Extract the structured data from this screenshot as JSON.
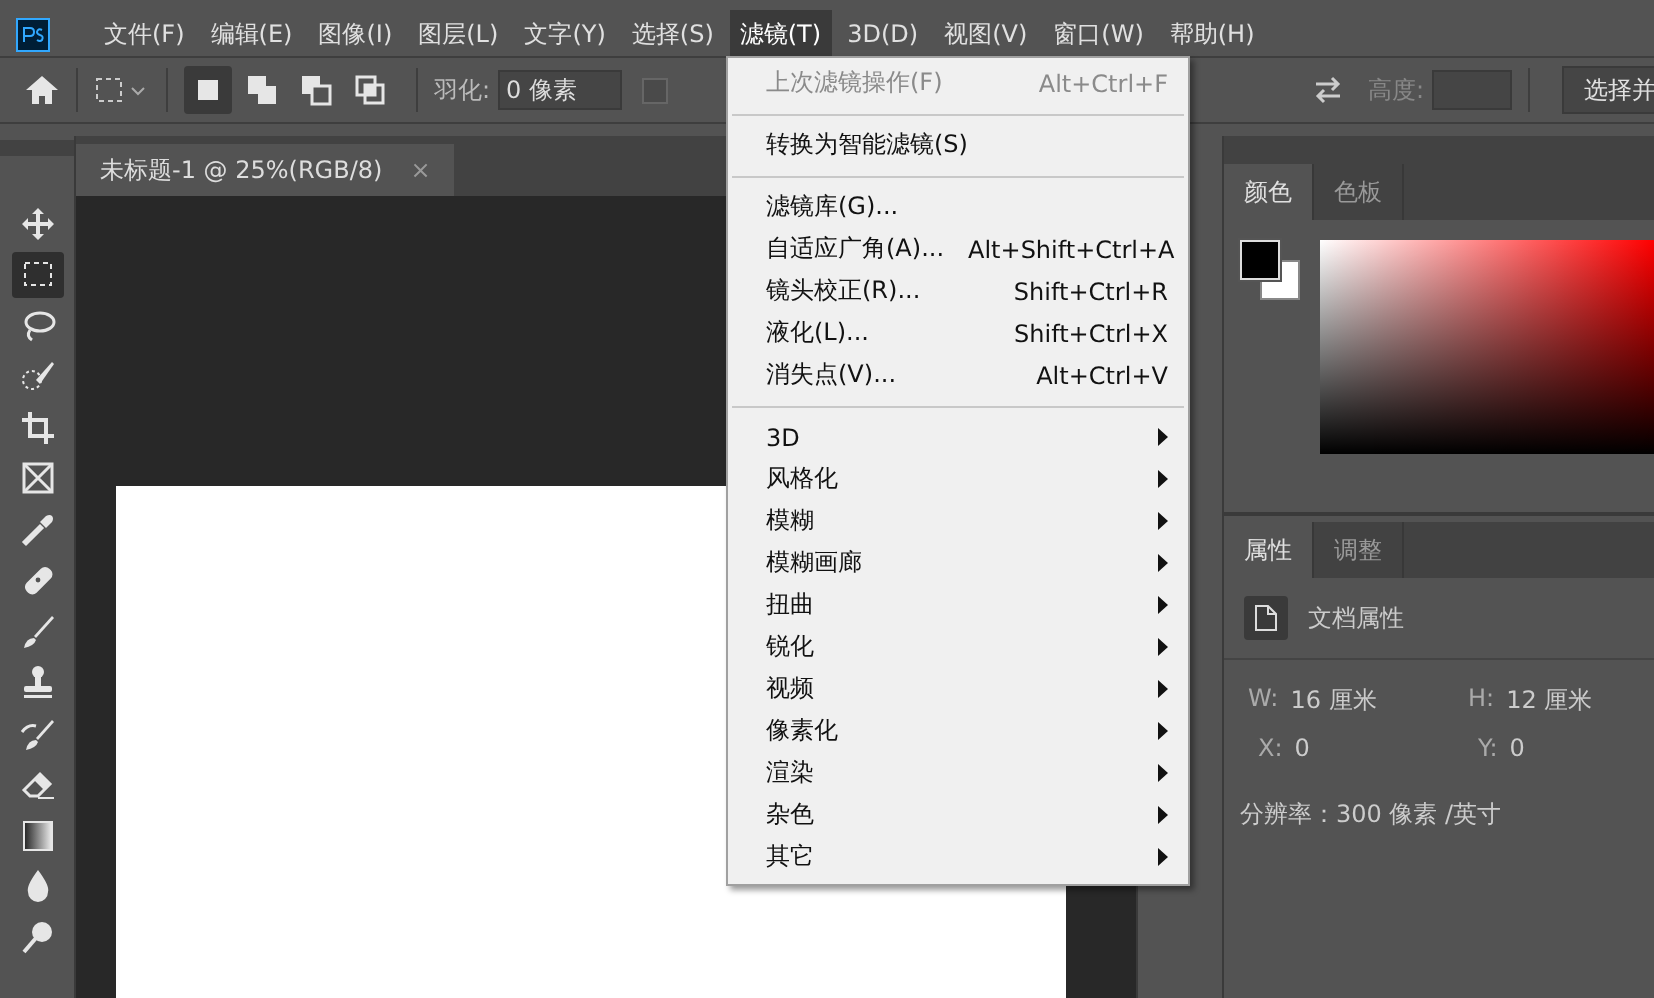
{
  "menubar": {
    "items": [
      {
        "label": "文件(F)",
        "selected": false
      },
      {
        "label": "编辑(E)",
        "selected": false
      },
      {
        "label": "图像(I)",
        "selected": false
      },
      {
        "label": "图层(L)",
        "selected": false
      },
      {
        "label": "文字(Y)",
        "selected": false
      },
      {
        "label": "选择(S)",
        "selected": false
      },
      {
        "label": "滤镜(T)",
        "selected": true
      },
      {
        "label": "3D(D)",
        "selected": false
      },
      {
        "label": "视图(V)",
        "selected": false
      },
      {
        "label": "窗口(W)",
        "selected": false
      },
      {
        "label": "帮助(H)",
        "selected": false
      }
    ]
  },
  "options_bar": {
    "modes": [
      {
        "kind": "new",
        "selected": true
      },
      {
        "kind": "add",
        "selected": false
      },
      {
        "kind": "subtract",
        "selected": false
      },
      {
        "kind": "intersect",
        "selected": false
      }
    ],
    "feather_label": "羽化:",
    "feather_value": "0 像素",
    "anti_alias_checked": false,
    "height_label": "高度:",
    "select_button": "选择并"
  },
  "toolbar": {
    "tools": [
      {
        "kind": "move",
        "selected": false
      },
      {
        "kind": "marquee",
        "selected": true
      },
      {
        "kind": "lasso",
        "selected": false
      },
      {
        "kind": "quick-select",
        "selected": false
      },
      {
        "kind": "crop",
        "selected": false
      },
      {
        "kind": "frame",
        "selected": false
      },
      {
        "kind": "eyedropper",
        "selected": false
      },
      {
        "kind": "healing",
        "selected": false
      },
      {
        "kind": "brush",
        "selected": false
      },
      {
        "kind": "stamp",
        "selected": false
      },
      {
        "kind": "history-brush",
        "selected": false
      },
      {
        "kind": "eraser",
        "selected": false
      },
      {
        "kind": "gradient",
        "selected": false
      },
      {
        "kind": "blur",
        "selected": false
      },
      {
        "kind": "dodge",
        "selected": false
      }
    ]
  },
  "document_tab": {
    "title": "未标题-1 @ 25%(RGB/8)",
    "close": "×"
  },
  "color_panel": {
    "tabs": [
      {
        "label": "颜色",
        "selected": true
      },
      {
        "label": "色板",
        "selected": false
      }
    ]
  },
  "properties_panel": {
    "tabs": [
      {
        "label": "属性",
        "selected": true
      },
      {
        "label": "调整",
        "selected": false
      }
    ],
    "title": "文档属性",
    "fields": [
      {
        "label": "W:",
        "value": "16 厘米"
      },
      {
        "label": "H:",
        "value": "12 厘米"
      },
      {
        "label": "X:",
        "value": "0"
      },
      {
        "label": "Y:",
        "value": "0"
      }
    ],
    "resolution": "分辨率：300 像素 /英寸"
  },
  "filter_menu": {
    "items": [
      {
        "kind": "item",
        "label": "上次滤镜操作(F)",
        "shortcut": "Alt+Ctrl+F",
        "disabled": true
      },
      {
        "kind": "separator"
      },
      {
        "kind": "item",
        "label": "转换为智能滤镜(S)",
        "disabled": false
      },
      {
        "kind": "separator"
      },
      {
        "kind": "item",
        "label": "滤镜库(G)...",
        "disabled": false
      },
      {
        "kind": "item",
        "label": "自适应广角(A)...",
        "shortcut": "Alt+Shift+Ctrl+A",
        "disabled": false
      },
      {
        "kind": "item",
        "label": "镜头校正(R)...",
        "shortcut": "Shift+Ctrl+R",
        "disabled": false
      },
      {
        "kind": "item",
        "label": "液化(L)...",
        "shortcut": "Shift+Ctrl+X",
        "disabled": false
      },
      {
        "kind": "item",
        "label": "消失点(V)...",
        "shortcut": "Alt+Ctrl+V",
        "disabled": false
      },
      {
        "kind": "separator"
      },
      {
        "kind": "submenu",
        "label": "3D"
      },
      {
        "kind": "submenu",
        "label": "风格化"
      },
      {
        "kind": "submenu",
        "label": "模糊"
      },
      {
        "kind": "submenu",
        "label": "模糊画廊"
      },
      {
        "kind": "submenu",
        "label": "扭曲"
      },
      {
        "kind": "submenu",
        "label": "锐化"
      },
      {
        "kind": "submenu",
        "label": "视频"
      },
      {
        "kind": "submenu",
        "label": "像素化"
      },
      {
        "kind": "submenu",
        "label": "渲染"
      },
      {
        "kind": "submenu",
        "label": "杂色"
      },
      {
        "kind": "submenu",
        "label": "其它"
      }
    ]
  }
}
